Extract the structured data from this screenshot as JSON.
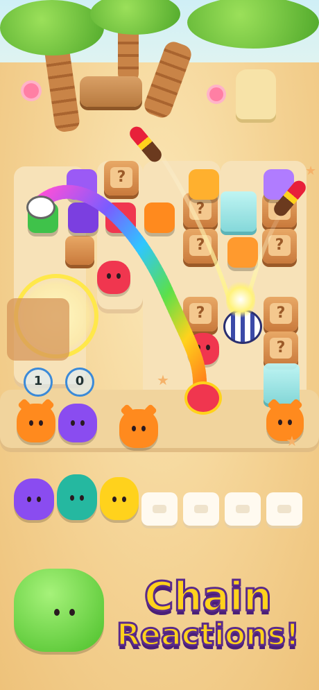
{
  "headline": {
    "line1": "Chain",
    "line2": "Reactions!"
  },
  "board": {
    "mystery_crate_label": "?",
    "counters": [
      "1",
      "0"
    ]
  },
  "tray": {
    "capacity": 7,
    "filled": 3
  },
  "colors": {
    "sand": "#f4d293",
    "crate": "#d58a4c",
    "orange_pet": "#ff8a1e",
    "purple_pet": "#8a4cf0",
    "teal_pet": "#25b8a0",
    "yellow_pet": "#ffd21c",
    "green_pet": "#5ad63a",
    "red_block": "#f0364f",
    "headline_fill": "#ffd21c",
    "headline_outline": "#5a2a8a"
  }
}
